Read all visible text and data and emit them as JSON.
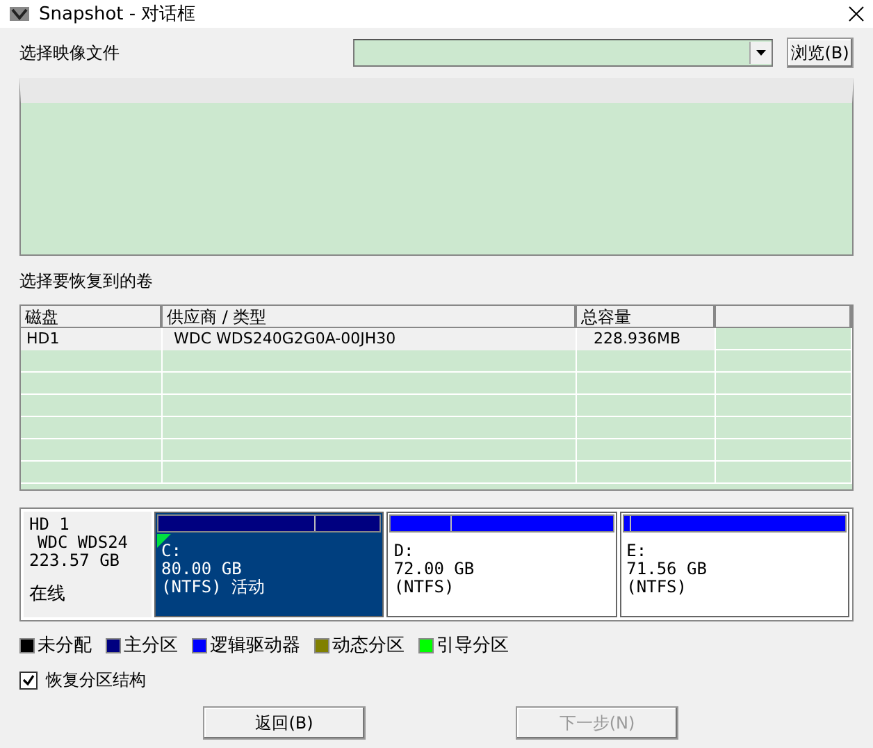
{
  "window": {
    "title": "Snapshot - 对话框"
  },
  "image_file": {
    "label": "选择映像文件",
    "browse_button": "浏览(B)"
  },
  "volume_section": {
    "label": "选择要恢复到的卷"
  },
  "table": {
    "columns": [
      "磁盘",
      "供应商 / 类型",
      "总容量"
    ],
    "rows": [
      {
        "cells": [
          "HD1",
          "WDC WDS240G2G0A-00JH30",
          "228.936MB"
        ],
        "selected": false
      }
    ]
  },
  "disk": {
    "name": "HD 1",
    "model": "WDC WDS24",
    "size": "223.57 GB",
    "status": "在线",
    "partitions": [
      {
        "letter": "C:",
        "size": "80.00 GB",
        "fs": "(NTFS) 活动",
        "kind": "primary",
        "level": 0.7,
        "boot": true,
        "selected": true
      },
      {
        "letter": "D:",
        "size": "72.00 GB",
        "fs": "(NTFS)",
        "kind": "logical",
        "level": 0.27,
        "boot": false,
        "selected": false
      },
      {
        "letter": "E:",
        "size": "71.56 GB",
        "fs": "(NTFS)",
        "kind": "logical",
        "level": 0.03,
        "boot": false,
        "selected": false
      }
    ]
  },
  "legend": [
    {
      "label": "未分配",
      "color": "#000000"
    },
    {
      "label": "主分区",
      "color": "#000080"
    },
    {
      "label": "逻辑驱动器",
      "color": "#0000ff"
    },
    {
      "label": "动态分区",
      "color": "#808000"
    },
    {
      "label": "引导分区",
      "color": "#00ff00"
    }
  ],
  "restore_structure": {
    "label": "恢复分区结构",
    "checked": true
  },
  "buttons": [
    {
      "label": "返回(B)",
      "disabled": false
    },
    {
      "label": "下一步(N)",
      "disabled": true
    }
  ]
}
